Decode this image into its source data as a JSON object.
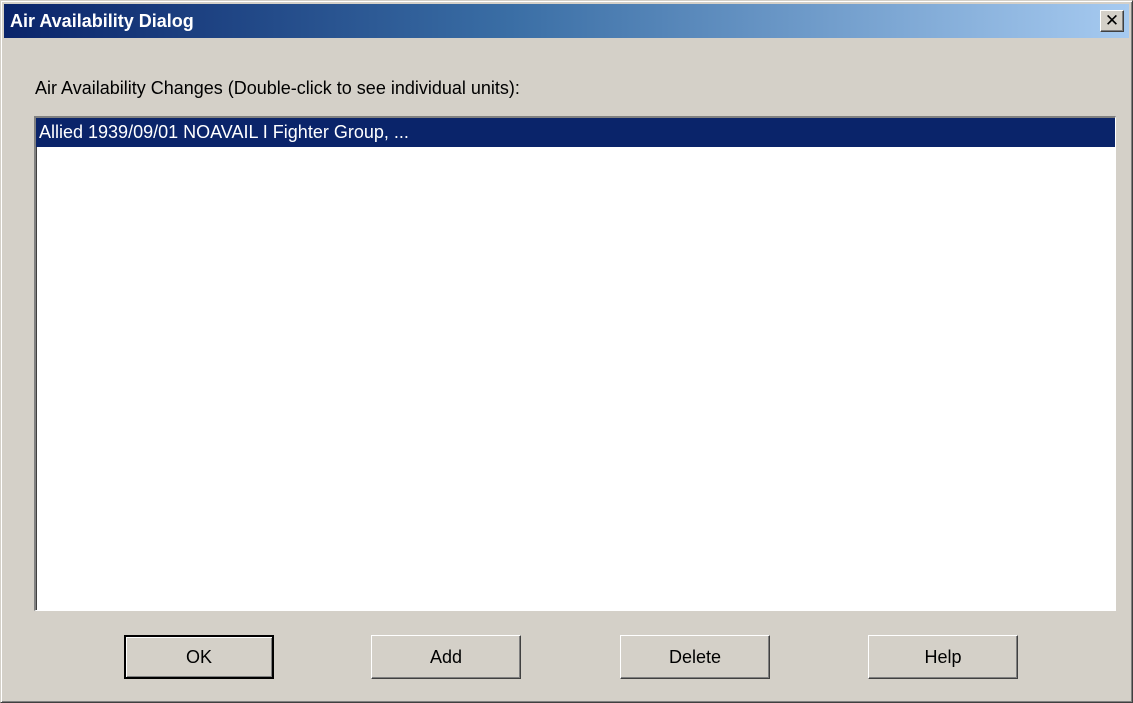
{
  "window": {
    "title": "Air Availability Dialog",
    "close_icon": "close-icon",
    "close_glyph": "✕"
  },
  "list": {
    "label": "Air Availability Changes (Double-click to see individual units):",
    "items": [
      {
        "text": "Allied 1939/09/01 NOAVAIL I Fighter Group, ...",
        "selected": true
      }
    ]
  },
  "buttons": {
    "ok": "OK",
    "add": "Add",
    "delete": "Delete",
    "help": "Help"
  },
  "colors": {
    "title_gradient_start": "#0a246a",
    "title_gradient_end": "#a6caf0",
    "selection": "#0a246a",
    "face": "#d4d0c8"
  }
}
